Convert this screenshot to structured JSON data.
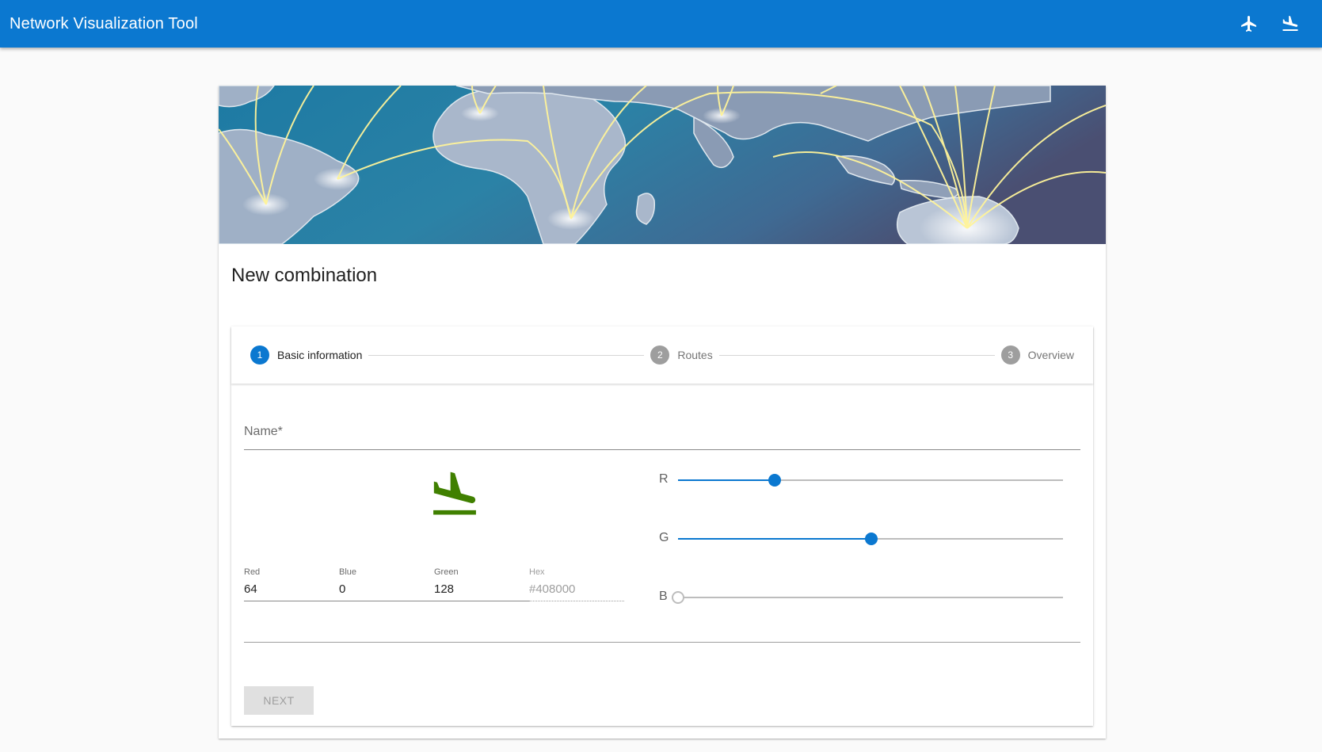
{
  "app": {
    "title": "Network Visualization Tool",
    "action_icons": [
      "airplane-icon",
      "flight-land-icon"
    ]
  },
  "card": {
    "title": "New combination"
  },
  "stepper": {
    "steps": [
      {
        "number": "1",
        "label": "Basic information",
        "active": true
      },
      {
        "number": "2",
        "label": "Routes",
        "active": false
      },
      {
        "number": "3",
        "label": "Overview",
        "active": false
      }
    ]
  },
  "form": {
    "name_label": "Name*",
    "name_value": "",
    "preview_icon": "flight-land-icon",
    "preview_color": "#408000",
    "fields": {
      "red": {
        "label": "Red",
        "value": "64"
      },
      "blue": {
        "label": "Blue",
        "value": "0"
      },
      "green": {
        "label": "Green",
        "value": "128"
      },
      "hex": {
        "label": "Hex",
        "value": "#408000"
      }
    },
    "sliders": {
      "r": {
        "label": "R",
        "value": 64,
        "max": 255
      },
      "g": {
        "label": "G",
        "value": 128,
        "max": 255
      },
      "b": {
        "label": "B",
        "value": 0,
        "max": 255
      }
    },
    "next_label": "NEXT"
  },
  "colors": {
    "primary": "#0b78d0",
    "route_lines": "#fff49a",
    "ocean": "#2c7fa0"
  }
}
